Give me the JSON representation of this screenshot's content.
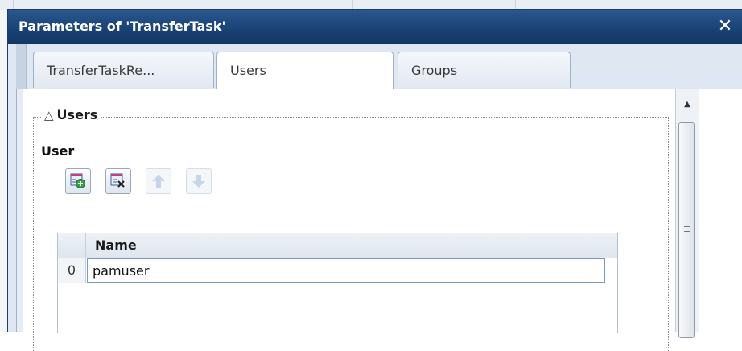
{
  "dialog": {
    "title": "Parameters of 'TransferTask'",
    "close_symbol": "✕"
  },
  "tabs": [
    {
      "label": "TransferTaskRe...",
      "active": false
    },
    {
      "label": "Users",
      "active": true
    },
    {
      "label": "Groups",
      "active": false
    }
  ],
  "section": {
    "legend_icon": "△",
    "legend": "Users",
    "field_label": "User"
  },
  "toolbar": [
    {
      "icon": "add-row-icon",
      "enabled": true
    },
    {
      "icon": "delete-row-icon",
      "enabled": true
    },
    {
      "icon": "move-up-icon",
      "enabled": false
    },
    {
      "icon": "move-down-icon",
      "enabled": false
    }
  ],
  "grid": {
    "column_header": "Name",
    "rows": [
      {
        "index": "0",
        "value": "pamuser"
      }
    ]
  },
  "scrollbar": {
    "up_symbol": "▲",
    "grip_icon": "grip-icon"
  },
  "colors": {
    "titlebar": "#1a4376",
    "border": "#9fb2c8",
    "input_border": "#7a99c2"
  }
}
